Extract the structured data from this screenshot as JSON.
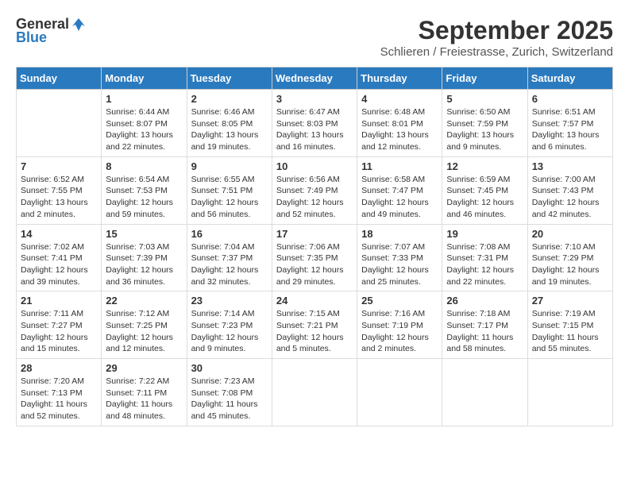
{
  "header": {
    "logo_general": "General",
    "logo_blue": "Blue",
    "month": "September 2025",
    "location": "Schlieren / Freiestrasse, Zurich, Switzerland"
  },
  "weekdays": [
    "Sunday",
    "Monday",
    "Tuesday",
    "Wednesday",
    "Thursday",
    "Friday",
    "Saturday"
  ],
  "weeks": [
    [
      {
        "day": "",
        "info": ""
      },
      {
        "day": "1",
        "info": "Sunrise: 6:44 AM\nSunset: 8:07 PM\nDaylight: 13 hours\nand 22 minutes."
      },
      {
        "day": "2",
        "info": "Sunrise: 6:46 AM\nSunset: 8:05 PM\nDaylight: 13 hours\nand 19 minutes."
      },
      {
        "day": "3",
        "info": "Sunrise: 6:47 AM\nSunset: 8:03 PM\nDaylight: 13 hours\nand 16 minutes."
      },
      {
        "day": "4",
        "info": "Sunrise: 6:48 AM\nSunset: 8:01 PM\nDaylight: 13 hours\nand 12 minutes."
      },
      {
        "day": "5",
        "info": "Sunrise: 6:50 AM\nSunset: 7:59 PM\nDaylight: 13 hours\nand 9 minutes."
      },
      {
        "day": "6",
        "info": "Sunrise: 6:51 AM\nSunset: 7:57 PM\nDaylight: 13 hours\nand 6 minutes."
      }
    ],
    [
      {
        "day": "7",
        "info": "Sunrise: 6:52 AM\nSunset: 7:55 PM\nDaylight: 13 hours\nand 2 minutes."
      },
      {
        "day": "8",
        "info": "Sunrise: 6:54 AM\nSunset: 7:53 PM\nDaylight: 12 hours\nand 59 minutes."
      },
      {
        "day": "9",
        "info": "Sunrise: 6:55 AM\nSunset: 7:51 PM\nDaylight: 12 hours\nand 56 minutes."
      },
      {
        "day": "10",
        "info": "Sunrise: 6:56 AM\nSunset: 7:49 PM\nDaylight: 12 hours\nand 52 minutes."
      },
      {
        "day": "11",
        "info": "Sunrise: 6:58 AM\nSunset: 7:47 PM\nDaylight: 12 hours\nand 49 minutes."
      },
      {
        "day": "12",
        "info": "Sunrise: 6:59 AM\nSunset: 7:45 PM\nDaylight: 12 hours\nand 46 minutes."
      },
      {
        "day": "13",
        "info": "Sunrise: 7:00 AM\nSunset: 7:43 PM\nDaylight: 12 hours\nand 42 minutes."
      }
    ],
    [
      {
        "day": "14",
        "info": "Sunrise: 7:02 AM\nSunset: 7:41 PM\nDaylight: 12 hours\nand 39 minutes."
      },
      {
        "day": "15",
        "info": "Sunrise: 7:03 AM\nSunset: 7:39 PM\nDaylight: 12 hours\nand 36 minutes."
      },
      {
        "day": "16",
        "info": "Sunrise: 7:04 AM\nSunset: 7:37 PM\nDaylight: 12 hours\nand 32 minutes."
      },
      {
        "day": "17",
        "info": "Sunrise: 7:06 AM\nSunset: 7:35 PM\nDaylight: 12 hours\nand 29 minutes."
      },
      {
        "day": "18",
        "info": "Sunrise: 7:07 AM\nSunset: 7:33 PM\nDaylight: 12 hours\nand 25 minutes."
      },
      {
        "day": "19",
        "info": "Sunrise: 7:08 AM\nSunset: 7:31 PM\nDaylight: 12 hours\nand 22 minutes."
      },
      {
        "day": "20",
        "info": "Sunrise: 7:10 AM\nSunset: 7:29 PM\nDaylight: 12 hours\nand 19 minutes."
      }
    ],
    [
      {
        "day": "21",
        "info": "Sunrise: 7:11 AM\nSunset: 7:27 PM\nDaylight: 12 hours\nand 15 minutes."
      },
      {
        "day": "22",
        "info": "Sunrise: 7:12 AM\nSunset: 7:25 PM\nDaylight: 12 hours\nand 12 minutes."
      },
      {
        "day": "23",
        "info": "Sunrise: 7:14 AM\nSunset: 7:23 PM\nDaylight: 12 hours\nand 9 minutes."
      },
      {
        "day": "24",
        "info": "Sunrise: 7:15 AM\nSunset: 7:21 PM\nDaylight: 12 hours\nand 5 minutes."
      },
      {
        "day": "25",
        "info": "Sunrise: 7:16 AM\nSunset: 7:19 PM\nDaylight: 12 hours\nand 2 minutes."
      },
      {
        "day": "26",
        "info": "Sunrise: 7:18 AM\nSunset: 7:17 PM\nDaylight: 11 hours\nand 58 minutes."
      },
      {
        "day": "27",
        "info": "Sunrise: 7:19 AM\nSunset: 7:15 PM\nDaylight: 11 hours\nand 55 minutes."
      }
    ],
    [
      {
        "day": "28",
        "info": "Sunrise: 7:20 AM\nSunset: 7:13 PM\nDaylight: 11 hours\nand 52 minutes."
      },
      {
        "day": "29",
        "info": "Sunrise: 7:22 AM\nSunset: 7:11 PM\nDaylight: 11 hours\nand 48 minutes."
      },
      {
        "day": "30",
        "info": "Sunrise: 7:23 AM\nSunset: 7:08 PM\nDaylight: 11 hours\nand 45 minutes."
      },
      {
        "day": "",
        "info": ""
      },
      {
        "day": "",
        "info": ""
      },
      {
        "day": "",
        "info": ""
      },
      {
        "day": "",
        "info": ""
      }
    ]
  ]
}
